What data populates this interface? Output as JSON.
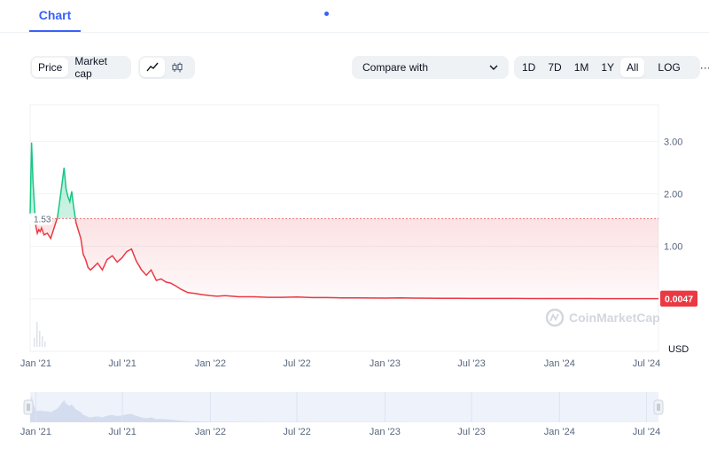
{
  "tabs": {
    "chart_label": "Chart"
  },
  "toolbar": {
    "price_label": "Price",
    "market_cap_label": "Market cap",
    "line_icon": "line-chart-icon",
    "candle_icon": "candlestick-icon",
    "compare_label": "Compare with",
    "ranges": [
      "1D",
      "7D",
      "1M",
      "1Y",
      "All"
    ],
    "active_range": "All",
    "log_label": "LOG",
    "more_label": "···"
  },
  "colors": {
    "up": "#16c784",
    "down": "#ea3943",
    "accent": "#3861fb",
    "grid": "#eff2f5"
  },
  "chart_data": {
    "type": "area",
    "y_ticks": [
      "3.00",
      "2.00",
      "1.00"
    ],
    "ylim": [
      -1,
      3.7
    ],
    "ylabel": "USD",
    "x_ticks": [
      "Jan '21",
      "Jul '21",
      "Jan '22",
      "Jul '22",
      "Jan '23",
      "Jul '23",
      "Jan '24",
      "Jul '24"
    ],
    "x_tick_dates": [
      "2021-01-01",
      "2021-07-01",
      "2022-01-01",
      "2022-07-01",
      "2023-01-01",
      "2023-07-01",
      "2024-01-01",
      "2024-07-01"
    ],
    "xlim": [
      "2020-12-20",
      "2024-07-26"
    ],
    "baseline_value": 1.53,
    "baseline_label": "1.53",
    "current_value": 0.0047,
    "current_label": "0.0047",
    "watermark": "CoinMarketCap",
    "grid": true,
    "series": [
      {
        "x": [
          "2020-12-20",
          "2020-12-23",
          "2020-12-26",
          "2020-12-29",
          "2021-01-01",
          "2021-01-04",
          "2021-01-07",
          "2021-01-10",
          "2021-01-13",
          "2021-01-18",
          "2021-01-25",
          "2021-02-01",
          "2021-02-08",
          "2021-02-15",
          "2021-02-22",
          "2021-03-01",
          "2021-03-05",
          "2021-03-09",
          "2021-03-13",
          "2021-03-17",
          "2021-03-21",
          "2021-03-26",
          "2021-03-31",
          "2021-04-05",
          "2021-04-10",
          "2021-04-15",
          "2021-04-20",
          "2021-04-25",
          "2021-05-01",
          "2021-05-10",
          "2021-05-20",
          "2021-05-30",
          "2021-06-10",
          "2021-06-20",
          "2021-06-30",
          "2021-07-10",
          "2021-07-20",
          "2021-07-30",
          "2021-08-10",
          "2021-08-20",
          "2021-08-30",
          "2021-09-10",
          "2021-09-20",
          "2021-09-30",
          "2021-10-10",
          "2021-10-20",
          "2021-11-01",
          "2021-11-15",
          "2021-12-01",
          "2021-12-15",
          "2022-01-01",
          "2022-01-15",
          "2022-02-01",
          "2022-03-01",
          "2022-04-01",
          "2022-05-01",
          "2022-06-01",
          "2022-07-01",
          "2022-08-01",
          "2022-09-01",
          "2022-10-01",
          "2022-11-01",
          "2022-12-01",
          "2023-01-01",
          "2023-02-01",
          "2023-03-01",
          "2023-04-01",
          "2023-05-01",
          "2023-06-01",
          "2023-07-01",
          "2023-08-01",
          "2023-09-01",
          "2023-10-01",
          "2023-11-01",
          "2023-12-01",
          "2024-01-01",
          "2024-02-01",
          "2024-03-01",
          "2024-04-01",
          "2024-05-01",
          "2024-06-01",
          "2024-07-01",
          "2024-07-26"
        ],
        "y": [
          1.62,
          2.98,
          2.25,
          1.75,
          1.38,
          1.25,
          1.32,
          1.28,
          1.35,
          1.22,
          1.25,
          1.15,
          1.35,
          1.55,
          2.0,
          2.5,
          2.1,
          1.95,
          1.85,
          2.05,
          1.75,
          1.45,
          1.3,
          1.15,
          0.85,
          0.75,
          0.6,
          0.55,
          0.6,
          0.68,
          0.55,
          0.75,
          0.82,
          0.7,
          0.78,
          0.9,
          0.95,
          0.72,
          0.55,
          0.45,
          0.55,
          0.35,
          0.38,
          0.32,
          0.3,
          0.25,
          0.18,
          0.12,
          0.1,
          0.08,
          0.06,
          0.05,
          0.06,
          0.04,
          0.04,
          0.03,
          0.03,
          0.035,
          0.025,
          0.025,
          0.02,
          0.018,
          0.016,
          0.015,
          0.02,
          0.015,
          0.012,
          0.01,
          0.009,
          0.008,
          0.008,
          0.007,
          0.007,
          0.006,
          0.006,
          0.006,
          0.0055,
          0.0055,
          0.005,
          0.005,
          0.005,
          0.0047,
          0.0047
        ]
      }
    ]
  },
  "navigator": {
    "x_ticks": [
      "Jan '21",
      "Jul '21",
      "Jan '22",
      "Jul '22",
      "Jan '23",
      "Jul '23",
      "Jan '24",
      "Jul '24"
    ]
  }
}
